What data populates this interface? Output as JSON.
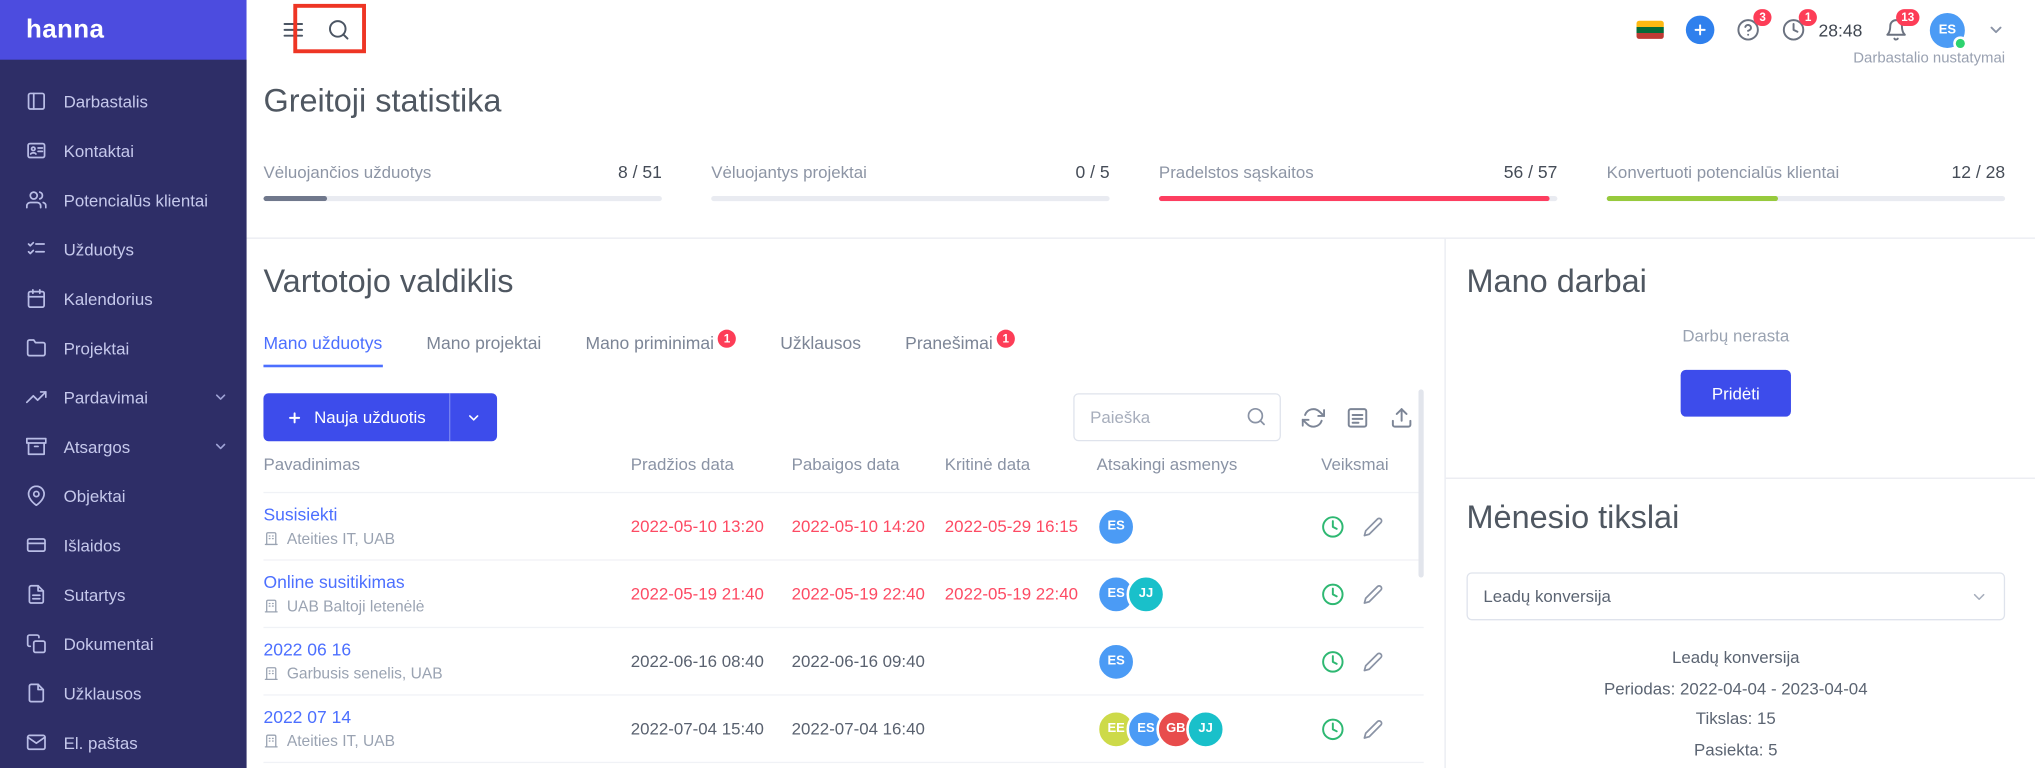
{
  "brand": {
    "logo": "hanna"
  },
  "colors": {
    "accent": "#3d4ceb",
    "link": "#4c6fff",
    "overdue": "#fd4a63",
    "sidebar_bg": "#2e2e67",
    "logo_bg": "#4c4cdf",
    "badge": "#fd3d57",
    "annotation": "#ee3524"
  },
  "sidebar": {
    "items": [
      {
        "label": "Darbastalis"
      },
      {
        "label": "Kontaktai"
      },
      {
        "label": "Potencialūs klientai"
      },
      {
        "label": "Užduotys"
      },
      {
        "label": "Kalendorius"
      },
      {
        "label": "Projektai"
      },
      {
        "label": "Pardavimai"
      },
      {
        "label": "Atsargos"
      },
      {
        "label": "Objektai"
      },
      {
        "label": "Išlaidos"
      },
      {
        "label": "Sutartys"
      },
      {
        "label": "Dokumentai"
      },
      {
        "label": "Užklausos"
      },
      {
        "label": "El. paštas"
      }
    ]
  },
  "topbar": {
    "help_badge": "3",
    "clock_badge": "1",
    "timer": "28:48",
    "bell_badge": "13",
    "avatar_initials": "ES",
    "settings_link": "Darbastalio nustatymai"
  },
  "quick_stats": {
    "title": "Greitoji statistika",
    "items": [
      {
        "label": "Vėluojančios užduotys",
        "value": "8 / 51",
        "pct": "16%",
        "color": "#70788c"
      },
      {
        "label": "Vėluojantys projektai",
        "value": "0 / 5",
        "pct": "0%",
        "color": "#70788c"
      },
      {
        "label": "Pradelstos sąskaitos",
        "value": "56 / 57",
        "pct": "98%",
        "color": "#fd3e60"
      },
      {
        "label": "Konvertuoti potencialūs klientai",
        "value": "12 / 28",
        "pct": "43%",
        "color": "#97ca3d"
      }
    ]
  },
  "widget": {
    "title": "Vartotojo valdiklis",
    "tabs": [
      {
        "label": "Mano užduotys"
      },
      {
        "label": "Mano projektai"
      },
      {
        "label": "Mano priminimai",
        "badge": "1"
      },
      {
        "label": "Užklausos"
      },
      {
        "label": "Pranešimai",
        "badge": "1"
      }
    ],
    "new_task_label": "Nauja užduotis",
    "search_placeholder": "Paieška",
    "table": {
      "headers": {
        "name": "Pavadinimas",
        "start": "Pradžios data",
        "end": "Pabaigos data",
        "critical": "Kritinė data",
        "assignees": "Atsakingi asmenys",
        "actions": "Veiksmai"
      },
      "rows": [
        {
          "name": "Susisiekti",
          "company": "Ateities IT, UAB",
          "start": "2022-05-10 13:20",
          "end": "2022-05-10 14:20",
          "critical": "2022-05-29 16:15",
          "assignees": [
            {
              "initials": "ES",
              "color": "#4b9bf5"
            }
          ]
        },
        {
          "name": "Online susitikimas",
          "company": "UAB Baltoji letenėlė",
          "start": "2022-05-19 21:40",
          "end": "2022-05-19 22:40",
          "critical": "2022-05-19 22:40",
          "assignees": [
            {
              "initials": "ES",
              "color": "#4b9bf5"
            },
            {
              "initials": "JJ",
              "color": "#19c0ca"
            }
          ]
        },
        {
          "name": "2022 06 16",
          "company": "Garbusis senelis, UAB",
          "start": "2022-06-16 08:40",
          "end": "2022-06-16 09:40",
          "critical": "",
          "assignees": [
            {
              "initials": "ES",
              "color": "#4b9bf5"
            }
          ]
        },
        {
          "name": "2022 07 14",
          "company": "Ateities IT, UAB",
          "start": "2022-07-04 15:40",
          "end": "2022-07-04 16:40",
          "critical": "",
          "assignees": [
            {
              "initials": "EE",
              "color": "#cdda49"
            },
            {
              "initials": "ES",
              "color": "#4b9bf5"
            },
            {
              "initials": "GB",
              "color": "#e84c4c"
            },
            {
              "initials": "JJ",
              "color": "#19c0ca"
            }
          ]
        }
      ]
    }
  },
  "my_jobs": {
    "title": "Mano darbai",
    "empty_text": "Darbų nerasta",
    "add_label": "Pridėti"
  },
  "monthly_goals": {
    "title": "Mėnesio tikslai",
    "select_value": "Leadų konversija",
    "goal_name": "Leadų konversija",
    "period": "Periodas: 2022-04-04 - 2023-04-04",
    "target": "Tikslas: 15",
    "achieved": "Pasiekta: 5"
  }
}
